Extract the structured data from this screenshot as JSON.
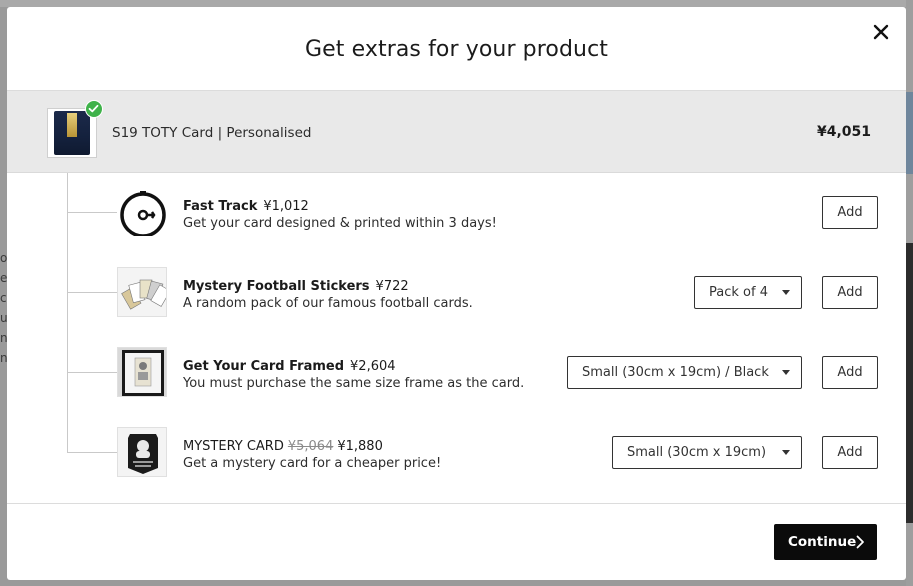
{
  "modal": {
    "title": "Get extras for your product",
    "close_icon": "close-icon"
  },
  "product": {
    "name": "S19 TOTY Card | Personalised",
    "price": "¥4,051",
    "selected_icon": "check-circle-icon"
  },
  "extras": [
    {
      "title": "Fast Track",
      "price": "¥1,012",
      "old_price": "",
      "description": "Get your card designed & printed within 3 days!",
      "option": "",
      "add_label": "Add",
      "icon": "stopwatch-icon"
    },
    {
      "title": "Mystery Football Stickers",
      "price": "¥722",
      "old_price": "",
      "description": "A random pack of our famous football cards.",
      "option": "Pack of 4",
      "add_label": "Add",
      "icon": "sticker-pack-icon"
    },
    {
      "title": "Get Your Card Framed",
      "price": "¥2,604",
      "old_price": "",
      "description": "You must purchase the same size frame as the card.",
      "option": "Small (30cm x 19cm) / Black",
      "add_label": "Add",
      "icon": "framed-card-icon"
    },
    {
      "title": "MYSTERY CARD",
      "price": "¥1,880",
      "old_price": "¥5,064",
      "description": "Get a mystery card for a cheaper price!",
      "option": "Small (30cm x 19cm)",
      "add_label": "Add",
      "icon": "mystery-card-icon"
    }
  ],
  "footer": {
    "continue_label": "Continue"
  },
  "backdrop": {
    "left_fragments": [
      "of",
      "e",
      "c",
      "u",
      "n",
      "n"
    ]
  },
  "colors": {
    "accent_dark": "#0b0b0b",
    "check_green": "#3fb24a",
    "product_row_bg": "#e9e9e9"
  }
}
